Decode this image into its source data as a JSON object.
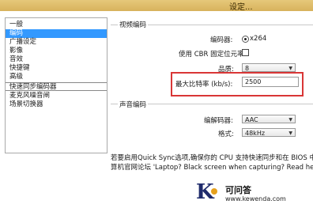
{
  "window": {
    "title": "设定..."
  },
  "sidebar": {
    "items": [
      {
        "label": "一般"
      },
      {
        "label": "编码"
      },
      {
        "label": "广播设定"
      },
      {
        "label": "影像"
      },
      {
        "label": "音效"
      },
      {
        "label": "快捷键"
      },
      {
        "label": "高级"
      },
      {
        "label": "快速同步编码器"
      },
      {
        "label": "麦克风噪音闸"
      },
      {
        "label": "场景切换器"
      }
    ],
    "selected_index": 1
  },
  "video": {
    "group_label": "视频编码",
    "encoder_label": "编码器:",
    "encoder_value": "x264",
    "cbr_label": "使用 CBR 固定位元率",
    "quality_label": "品质:",
    "quality_value": "8",
    "max_bitrate_label": "最大比特率 (kb/s):",
    "max_bitrate_value": "2500"
  },
  "audio": {
    "group_label": "声音编码",
    "codec_label": "编解码器:",
    "codec_value": "AAC",
    "format_label": "格式:",
    "format_value": "48kHz"
  },
  "notice": {
    "line1": "若要启用Quick Sync选项,确保你的 CPU 支持快速同步和在 BIOS 中启",
    "line2": "算机官网论坛 'Laptop? Black screen when capturing? Read here first.'"
  },
  "watermark": {
    "mark": "K",
    "name": "可问答",
    "url": "www.kewenda.com"
  }
}
